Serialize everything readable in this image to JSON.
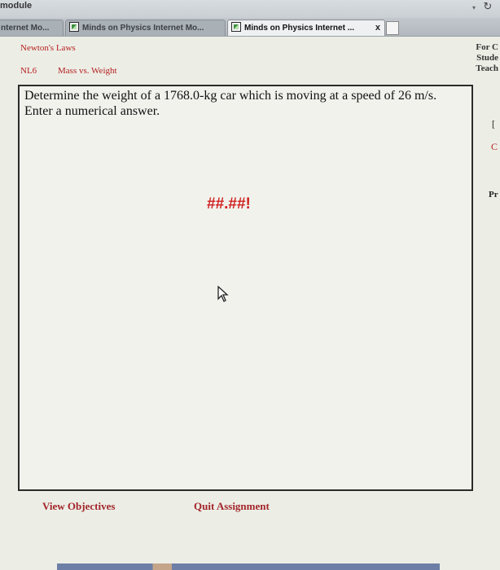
{
  "browser": {
    "url_fragment": "module",
    "tabs": [
      {
        "label": "nternet Mo..."
      },
      {
        "label": "Minds on Physics Internet Mo..."
      },
      {
        "label": "Minds on Physics Internet ...",
        "active": true
      }
    ],
    "close_glyph": "x"
  },
  "header": {
    "unit": "Newton's Laws",
    "code": "NL6",
    "topic": "Mass vs. Weight"
  },
  "right_panel": {
    "lines": [
      "For C",
      "Stude",
      "Teach"
    ],
    "mark_c": "C",
    "mark_pr": "Pr",
    "mark_bracket": "["
  },
  "question": {
    "text": "Determine the weight of a 1768.0-kg car which is moving at a speed of 26 m/s.  Enter a numerical answer.",
    "answer_display": "##.##!"
  },
  "footer": {
    "view_objectives": "View Objectives",
    "quit_assignment": "Quit Assignment"
  },
  "colors": {
    "link_red": "#a3252a",
    "answer_red": "#d01f1f"
  }
}
